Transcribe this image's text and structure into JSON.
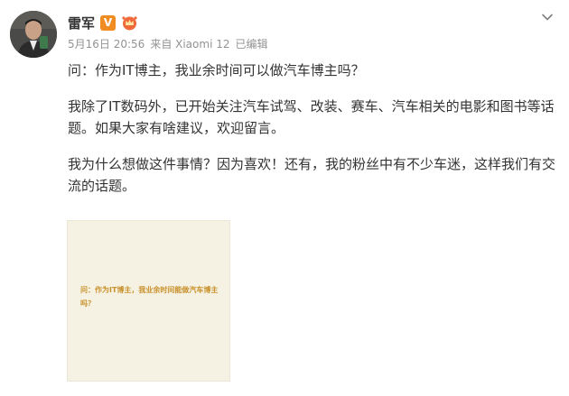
{
  "author": {
    "name": "雷军",
    "verified_mark": "V",
    "verified_color": "#f18c23",
    "member_icon": "member-crown-icon"
  },
  "meta": {
    "date": "5月16日 20:56",
    "source": "来自 Xiaomi 12",
    "edited": "已编辑"
  },
  "post": {
    "paragraphs": [
      "问：作为IT博主，我业余时间可以做汽车博主吗？",
      "我除了IT数码外，已开始关注汽车试驾、改装、赛车、汽车相关的电影和图书等话题。如果大家有啥建议，欢迎留言。",
      "我为什么想做这件事情？因为喜欢！还有，我的粉丝中有不少车迷，这样我们有交流的话题。"
    ]
  },
  "image": {
    "caption": "问：作为IT博主，我业余时间能做汽车博主吗？",
    "background": "#f6f2e3",
    "text_color": "#c8902a"
  },
  "controls": {
    "menu_icon": "chevron-down-icon"
  }
}
